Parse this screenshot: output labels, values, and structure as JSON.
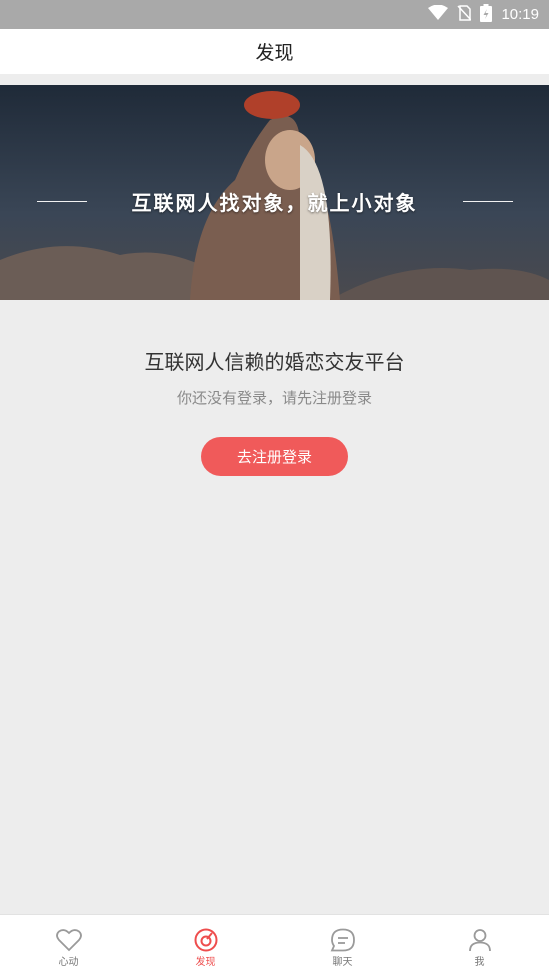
{
  "status_bar": {
    "time": "10:19"
  },
  "header": {
    "title": "发现"
  },
  "banner": {
    "slogan": "互联网人找对象，就上小对象"
  },
  "promo": {
    "title": "互联网人信赖的婚恋交友平台",
    "subtitle": "你还没有登录，请先注册登录",
    "button_label": "去注册登录"
  },
  "tabs": [
    {
      "label": "心动",
      "icon": "heart-icon",
      "active": false
    },
    {
      "label": "发现",
      "icon": "discover-icon",
      "active": true
    },
    {
      "label": "聊天",
      "icon": "chat-icon",
      "active": false
    },
    {
      "label": "我",
      "icon": "profile-icon",
      "active": false
    }
  ],
  "colors": {
    "accent": "#f05a5a",
    "background": "#ededed",
    "status_bar": "#a9a9a9"
  }
}
